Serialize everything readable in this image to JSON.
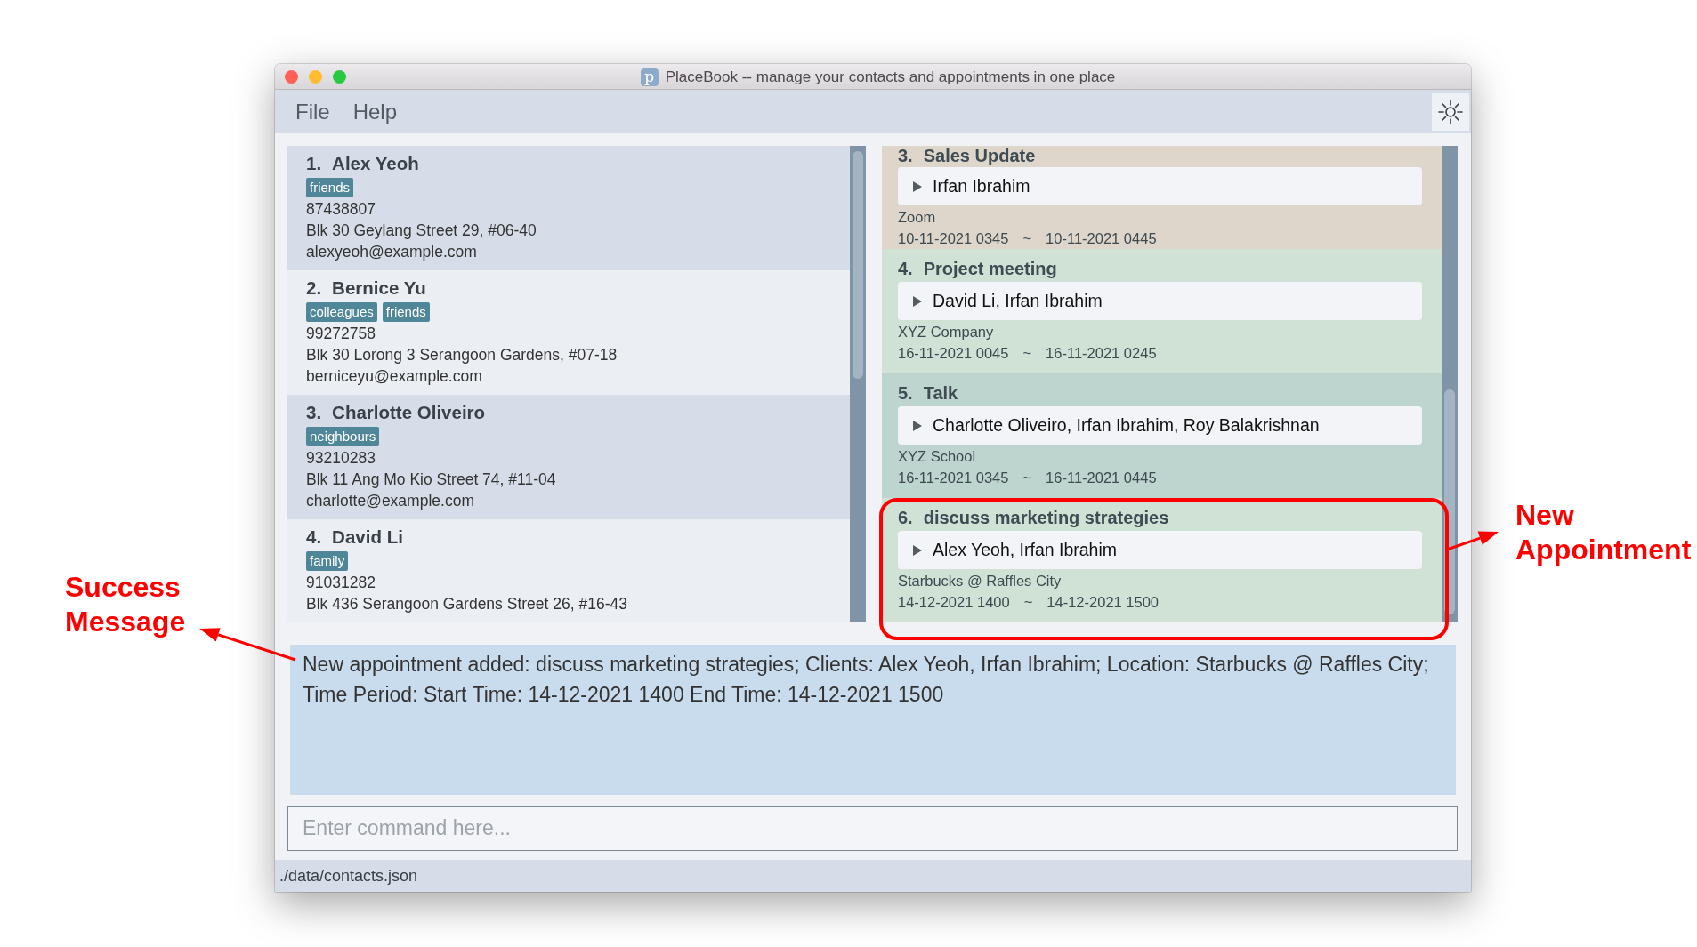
{
  "window": {
    "title": "PlaceBook -- manage your contacts and appointments in one place",
    "icon_text": "p"
  },
  "menu": [
    {
      "label": "File"
    },
    {
      "label": "Help"
    }
  ],
  "contacts": [
    {
      "number": "1.",
      "name": "Alex Yeoh",
      "tags": [
        "friends"
      ],
      "phone": "87438807",
      "address": "Blk 30 Geylang Street 29, #06-40",
      "email": "alexyeoh@example.com"
    },
    {
      "number": "2.",
      "name": "Bernice Yu",
      "tags": [
        "colleagues",
        "friends"
      ],
      "phone": "99272758",
      "address": "Blk 30 Lorong 3 Serangoon Gardens, #07-18",
      "email": "berniceyu@example.com"
    },
    {
      "number": "3.",
      "name": "Charlotte Oliveiro",
      "tags": [
        "neighbours"
      ],
      "phone": "93210283",
      "address": "Blk 11 Ang Mo Kio Street 74, #11-04",
      "email": "charlotte@example.com"
    },
    {
      "number": "4.",
      "name": "David Li",
      "tags": [
        "family"
      ],
      "phone": "91031282",
      "address": "Blk 436 Serangoon Gardens Street 26, #16-43"
    }
  ],
  "appointments": [
    {
      "number": "3.",
      "title": "Sales Update",
      "clients": "Irfan Ibrahim",
      "expanded": false,
      "location": "Zoom",
      "start": "10-11-2021 0345",
      "separator": "~",
      "end": "10-11-2021 0445",
      "color": "#ded6cb",
      "highlighted": false
    },
    {
      "number": "4.",
      "title": "Project meeting",
      "clients": "David Li, Irfan Ibrahim",
      "expanded": false,
      "location": "XYZ Company",
      "start": "16-11-2021 0045",
      "separator": "~",
      "end": "16-11-2021 0245",
      "color": "#d0e1d6",
      "highlighted": false
    },
    {
      "number": "5.",
      "title": "Talk",
      "clients": "Charlotte Oliveiro, Irfan Ibrahim, Roy Balakrishnan",
      "expanded": false,
      "location": "XYZ School",
      "start": "16-11-2021 0345",
      "separator": "~",
      "end": "16-11-2021 0445",
      "color": "#bed4cf",
      "highlighted": false
    },
    {
      "number": "6.",
      "title": "discuss marketing strategies",
      "clients": "Alex Yeoh, Irfan Ibrahim",
      "expanded": false,
      "location": "Starbucks @ Raffles City",
      "start": "14-12-2021 1400",
      "separator": "~",
      "end": "14-12-2021 1500",
      "color": "#d0e1d6",
      "highlighted": true
    }
  ],
  "result": "New appointment added: discuss marketing strategies; Clients: Alex Yeoh, Irfan Ibrahim; Location: Starbucks @ Raffles City; Time Period: Start Time: 14-12-2021 1400 End Time: 14-12-2021 1500",
  "command": {
    "placeholder": "Enter command here..."
  },
  "status_bar": "./data/contacts.json",
  "annotations": [
    {
      "text": "Success Message",
      "kind": "result"
    },
    {
      "text": "New Appointment",
      "kind": "highlight"
    }
  ]
}
